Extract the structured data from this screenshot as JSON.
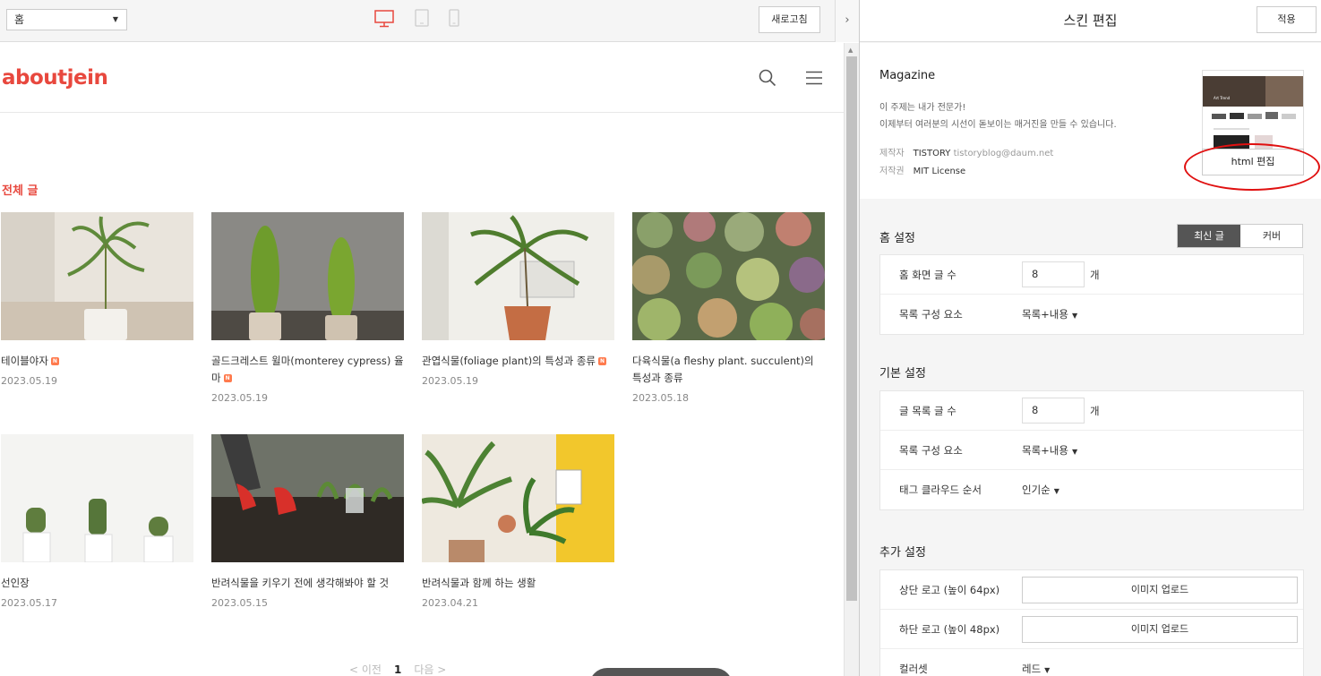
{
  "toolbar": {
    "page_select_value": "홈",
    "refresh_label": "새로고침",
    "collapse_glyph": "›",
    "active_device_color": "#e8483e"
  },
  "blog": {
    "title": "aboutjein",
    "category_title": "전체 글",
    "posts": [
      {
        "title": "테이블야자",
        "date": "2023.05.19",
        "new": true
      },
      {
        "title": "골드크레스트 윌마(monterey cypress) 율마",
        "date": "2023.05.19",
        "new": true
      },
      {
        "title": "관엽식물(foliage plant)의 특성과 종류",
        "date": "2023.05.19",
        "new": true
      },
      {
        "title": "다육식물(a fleshy plant. succulent)의 특성과 종류",
        "date": "2023.05.18",
        "new": false
      },
      {
        "title": "선인장",
        "date": "2023.05.17",
        "new": false
      },
      {
        "title": "반려식물을 키우기 전에 생각해봐야 할 것",
        "date": "2023.05.15",
        "new": false
      },
      {
        "title": "반려식물과 함께 하는 생활",
        "date": "2023.04.21",
        "new": false
      }
    ],
    "new_badge": "N",
    "pagination": {
      "prev": "< 이전",
      "current": "1",
      "next": "다음 >"
    }
  },
  "panel": {
    "title": "스킨 편집",
    "apply_label": "적용",
    "skin": {
      "name": "Magazine",
      "desc1": "이 주제는 내가 전문가!",
      "desc2": "이제부터 여러분의 시선이 돋보이는 매거진을 만들 수 있습니다.",
      "maker_label": "제작자",
      "maker_value": "TISTORY",
      "maker_email": "tistoryblog@daum.net",
      "license_label": "저작권",
      "license_value": "MIT License",
      "thumb_caption": "Art Trend",
      "html_edit_label": "html 편집"
    },
    "home": {
      "title": "홈 설정",
      "toggle_latest": "최신 글",
      "toggle_cover": "커버",
      "rows": {
        "post_count_label": "홈 화면 글 수",
        "post_count_value": "8",
        "unit": "개",
        "list_label": "목록 구성 요소",
        "list_value": "목록+내용"
      }
    },
    "basic": {
      "title": "기본 설정",
      "rows": {
        "post_count_label": "글 목록 글 수",
        "post_count_value": "8",
        "unit": "개",
        "list_label": "목록 구성 요소",
        "list_value": "목록+내용",
        "tag_label": "태그 클라우드 순서",
        "tag_value": "인기순"
      }
    },
    "extra": {
      "title": "추가 설정",
      "rows": {
        "top_logo_label": "상단 로고 (높이 64px)",
        "bottom_logo_label": "하단 로고 (높이 48px)",
        "upload_label": "이미지 업로드",
        "colorset_label": "컬러셋",
        "colorset_value": "레드"
      }
    },
    "highlight_color": "#e01010"
  }
}
